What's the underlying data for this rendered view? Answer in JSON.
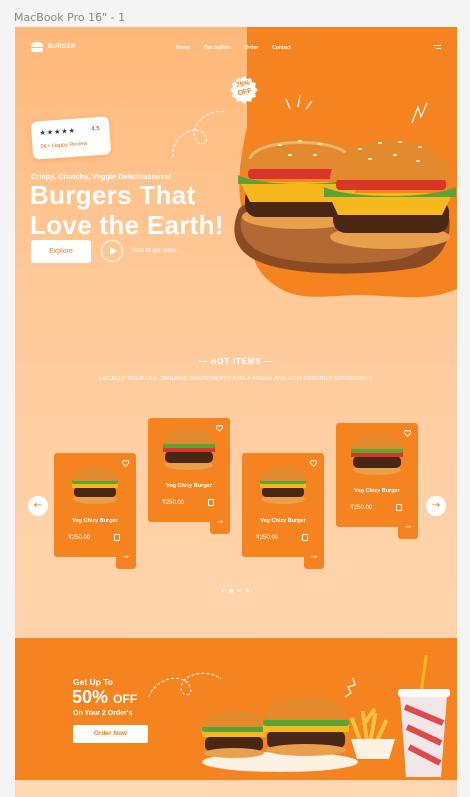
{
  "frame_label": "MacBook Pro 16\" - 1",
  "brand": {
    "name": "BURGER"
  },
  "nav": [
    "Home",
    "Our outlets",
    "Order",
    "Contact"
  ],
  "hero": {
    "rating_stars": "★★★★★",
    "rating_value": "4.5",
    "review_count": "5K+ Happy Review",
    "tagline": "Crispy, Crunchy, Veggie Deliciousness!",
    "title_line1": "Burgers That",
    "title_line2": "Love the Earth!",
    "explore": "Explore",
    "how_to": "How to get order...",
    "discount_line1": "75%",
    "discount_line2": "OFF"
  },
  "hot_items": {
    "title": "— HOT ITEMS —",
    "subtitle": "LOCALLY SOURCED, ORGANIC INGREDIENTS FOR A FRESH AND ECO-FRIENDLY EXPERIENCE",
    "cards": [
      {
        "name": "Veg Chizy Burger",
        "price": "₹250.00"
      },
      {
        "name": "Veg Chizy Burger",
        "price": "₹250.00"
      },
      {
        "name": "Veg Chizy Burger",
        "price": "₹250.00"
      },
      {
        "name": "Veg Chizy Burger",
        "price": "₹250.00"
      }
    ],
    "prev": "←",
    "next": "→"
  },
  "offer": {
    "get_up_to": "Get Up To",
    "percent": "50%",
    "off": "OFF",
    "on_orders": "On Your 2 Order's",
    "order_now": "Order Now"
  },
  "colors": {
    "accent": "#f5831f",
    "text_on_accent": "#ffffff"
  }
}
